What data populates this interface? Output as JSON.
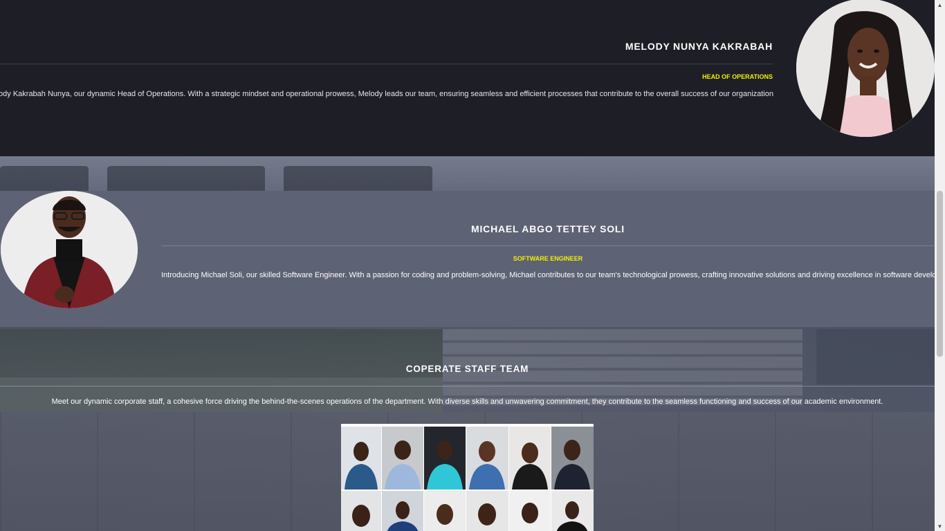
{
  "melody": {
    "name": "MELODY NUNYA KAKRABAH",
    "role": "HEAD OF OPERATIONS",
    "bio": "Meet Melody Kakrabah Nunya, our dynamic Head of Operations. With a strategic mindset and operational prowess, Melody leads our team, ensuring seamless and efficient processes that contribute to the overall success of our organization"
  },
  "michael": {
    "name": "MICHAEL ABGO TETTEY SOLI",
    "role": "SOFTWARE ENGINEER",
    "bio": "Introducing Michael Soli, our skilled Software Engineer. With a passion for coding and problem-solving, Michael contributes to our team's technological prowess, crafting innovative solutions and driving excellence in software development."
  },
  "team": {
    "title": "COPERATE STAFF TEAM",
    "description": "Meet our dynamic corporate staff, a cohesive force driving the behind-the-scenes operations of the department. With diverse skills and unwavering commitment, they contribute to the seamless functioning and success of our academic environment."
  },
  "colors": {
    "accent_yellow": "#f3f000",
    "dark_section": "#1e1f26",
    "slate_section": "#5d6275"
  },
  "icons": {
    "scroll_up": "▲",
    "scroll_down": "▼"
  }
}
